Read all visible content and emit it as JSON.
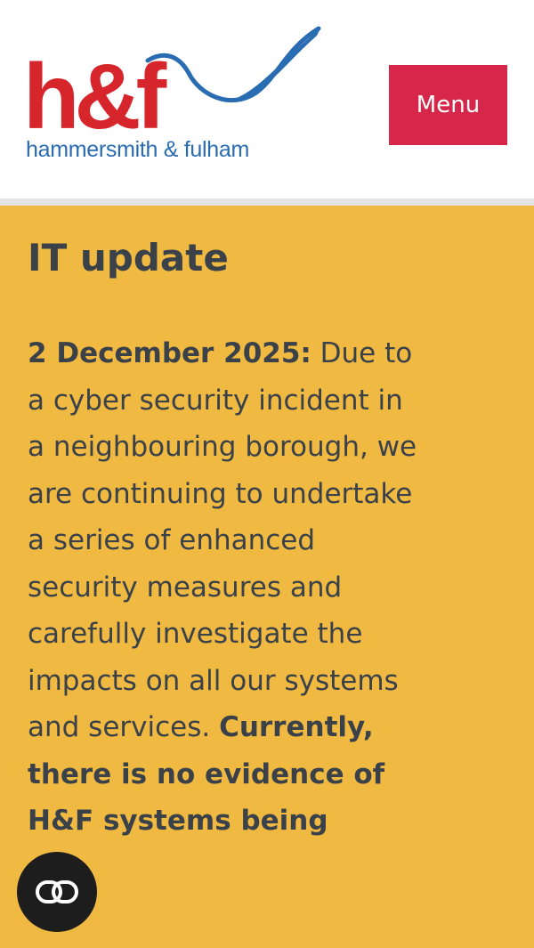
{
  "header": {
    "logo_text": "h&f",
    "logo_subtitle": "hammersmith & fulham",
    "menu_label": "Menu"
  },
  "alert": {
    "title": "IT update",
    "date": "2 December 2025:",
    "message": " Due to a cyber security incident in a neighbouring borough, we are continuing to undertake a series of enhanced security measures and carefully investigate the impacts on all our systems and services. ",
    "note_bold": "Currently, there is no evidence of H&F systems being"
  },
  "colors": {
    "brand_red": "#d6264a",
    "brand_blue": "#2a6cb2",
    "alert_background": "#f0b942",
    "text": "#3a4149"
  },
  "icons": {
    "chat": "chat-icon"
  }
}
